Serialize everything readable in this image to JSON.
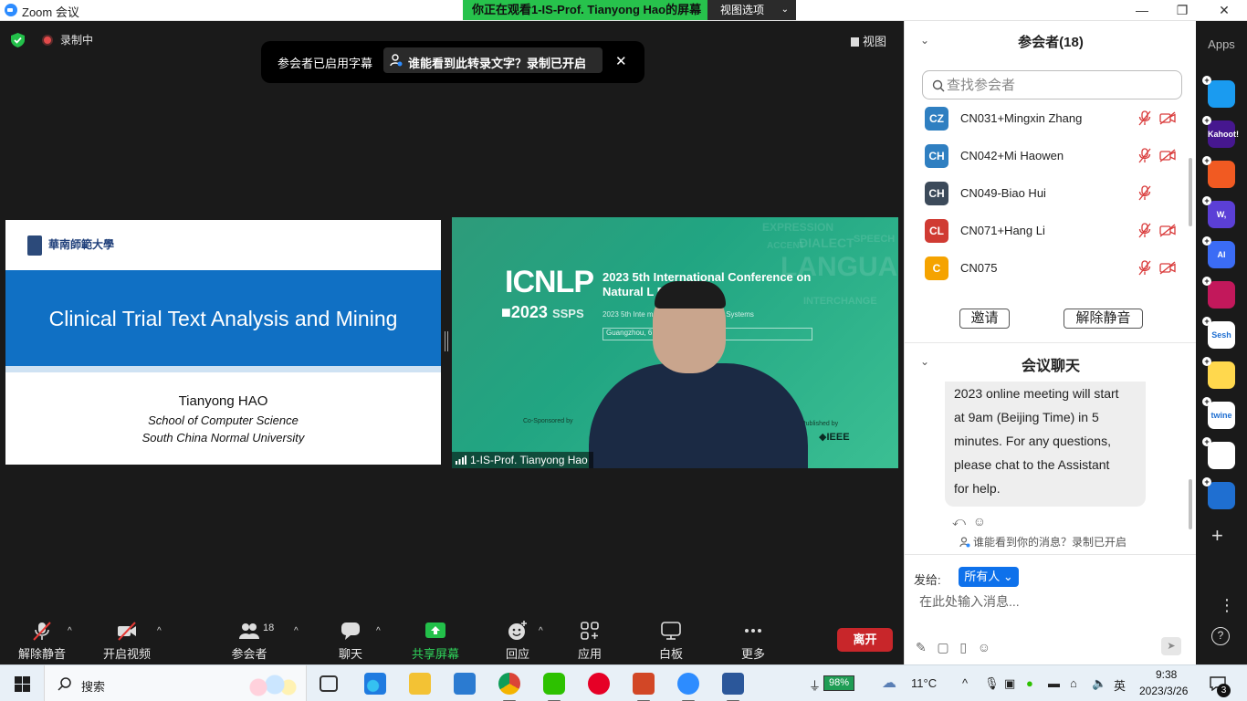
{
  "titlebar": {
    "app_title": "Zoom 会议",
    "viewing_banner": "你正在观看1-IS-Prof. Tianyong Hao的屏幕",
    "view_options": "视图选项"
  },
  "stage": {
    "recording_label": "录制中",
    "view_label": "视图",
    "caption_toast": {
      "text": "参会者已启用字幕",
      "link": "谁能看到此转录文字？录制已开启"
    }
  },
  "slide": {
    "university_logo_text": "華南師範大學",
    "title": "Clinical Trial Text Analysis and Mining",
    "author": "Tianyong HAO",
    "school": "School of Computer Science",
    "university": "South China Normal University"
  },
  "video": {
    "brand": "ICNLP",
    "year": "2023",
    "ssps": "SSPS",
    "conf_line1": "2023 5th International Conference on",
    "conf_line2": "Natural L      Processing",
    "conf_line3": "2023 5th Inte                m on Signal Processing Systems",
    "location": "Guangzhou,                6, 2023 (GMT+8)",
    "co_sponsored": "Co-Sponsored by",
    "published_by": "Published by",
    "ieee": "IEEE",
    "bg_words": [
      "EXPRESSION",
      "DIALECT",
      "SPEECH",
      "ACCENT",
      "LANGUAGE",
      "INTERCHANGE"
    ],
    "participant_name": "1-IS-Prof. Tianyong Hao"
  },
  "toolbar": {
    "unmute": "解除静音",
    "start_video": "开启视频",
    "participants": "参会者",
    "participants_count": "18",
    "chat": "聊天",
    "share_screen": "共享屏幕",
    "reactions": "回应",
    "apps": "应用",
    "whiteboard": "白板",
    "more": "更多",
    "leave": "离开"
  },
  "participants_panel": {
    "title": "参会者(18)",
    "search_placeholder": "查找参会者",
    "participants": [
      {
        "initials": "CZ",
        "name": "CN031+Mingxin Zhang",
        "color": "#2f7fc1",
        "muted": true,
        "video_off": true
      },
      {
        "initials": "CH",
        "name": "CN042+Mi Haowen",
        "color": "#2f7fc1",
        "muted": true,
        "video_off": true
      },
      {
        "initials": "CH",
        "name": "CN049-Biao Hui",
        "color": "#3c4a5a",
        "muted": true,
        "video_off": false
      },
      {
        "initials": "CL",
        "name": "CN071+Hang Li",
        "color": "#d03b33",
        "muted": true,
        "video_off": true
      },
      {
        "initials": "C",
        "name": "CN075",
        "color": "#f5a300",
        "muted": true,
        "video_off": true
      }
    ],
    "invite": "邀请",
    "unmute_me": "解除静音"
  },
  "chat_panel": {
    "title": "会议聊天",
    "message_lines": [
      "2023 online meeting will start",
      "at 9am (Beijing Time) in 5",
      "minutes. For any questions,",
      "please chat to the Assistant",
      "for help."
    ],
    "record_note": "谁能看到你的消息？录制已开启",
    "send_to_label": "发给:",
    "recipient": "所有人",
    "input_placeholder": "在此处输入消息..."
  },
  "apps_strip": {
    "label": "Apps",
    "apps": [
      {
        "name": "pointer-app",
        "text": "",
        "color": "#1a9bf0"
      },
      {
        "name": "kahoot-app",
        "text": "Kahoot!",
        "color": "#46178f"
      },
      {
        "name": "orange-app",
        "text": "",
        "color": "#f15a22"
      },
      {
        "name": "wooclap-app",
        "text": "W,",
        "color": "#5b3fd6"
      },
      {
        "name": "ai-companion-app",
        "text": "AI",
        "color": "#3b6cf5"
      },
      {
        "name": "clips-app",
        "text": "",
        "color": "#c2185b"
      },
      {
        "name": "sesh-app",
        "text": "Sesh",
        "color": "#ffffff"
      },
      {
        "name": "smiley-app",
        "text": "",
        "color": "#ffd84d"
      },
      {
        "name": "twine-app",
        "text": "twine",
        "color": "#ffffff"
      },
      {
        "name": "blocks-app",
        "text": "",
        "color": "#ffffff"
      },
      {
        "name": "sync-app",
        "text": "",
        "color": "#1f6fd1"
      }
    ]
  },
  "taskbar": {
    "search_label": "搜索",
    "battery": "98%",
    "weather": "11°C",
    "ime": "英",
    "time": "9:38",
    "date": "2023/3/26",
    "notifications": "3"
  }
}
